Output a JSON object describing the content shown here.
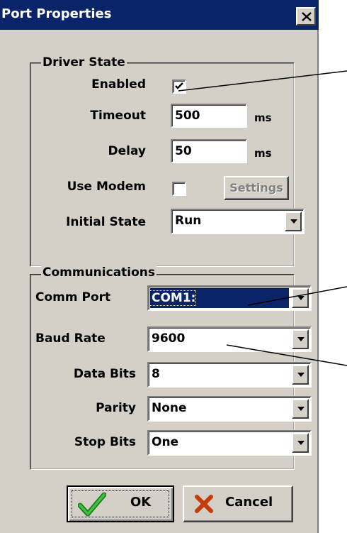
{
  "window": {
    "title": "Port Properties",
    "close_label": "X"
  },
  "driver_state": {
    "legend": "Driver State",
    "enabled_label": "Enabled",
    "enabled_checked": true,
    "timeout_label": "Timeout",
    "timeout_value": "500",
    "timeout_unit": "ms",
    "delay_label": "Delay",
    "delay_value": "50",
    "delay_unit": "ms",
    "use_modem_label": "Use Modem",
    "use_modem_checked": false,
    "settings_label": "Settings",
    "initial_state_label": "Initial State",
    "initial_state_value": "Run"
  },
  "communications": {
    "legend": "Communications",
    "comm_port_label": "Comm Port",
    "comm_port_value": "COM1:",
    "baud_rate_label": "Baud Rate",
    "baud_rate_value": "9600",
    "data_bits_label": "Data Bits",
    "data_bits_value": "8",
    "parity_label": "Parity",
    "parity_value": "None",
    "stop_bits_label": "Stop Bits",
    "stop_bits_value": "One"
  },
  "buttons": {
    "ok_label": "OK",
    "cancel_label": "Cancel"
  },
  "colors": {
    "title_bar": "#0a246a",
    "dialog_face": "#d4d0c8",
    "ok_check": "#2fa12f",
    "cancel_x": "#d84a10"
  },
  "icons": {
    "close": "close-icon",
    "ok": "checkmark-icon",
    "cancel": "x-icon",
    "dropdown": "chevron-down-icon"
  }
}
